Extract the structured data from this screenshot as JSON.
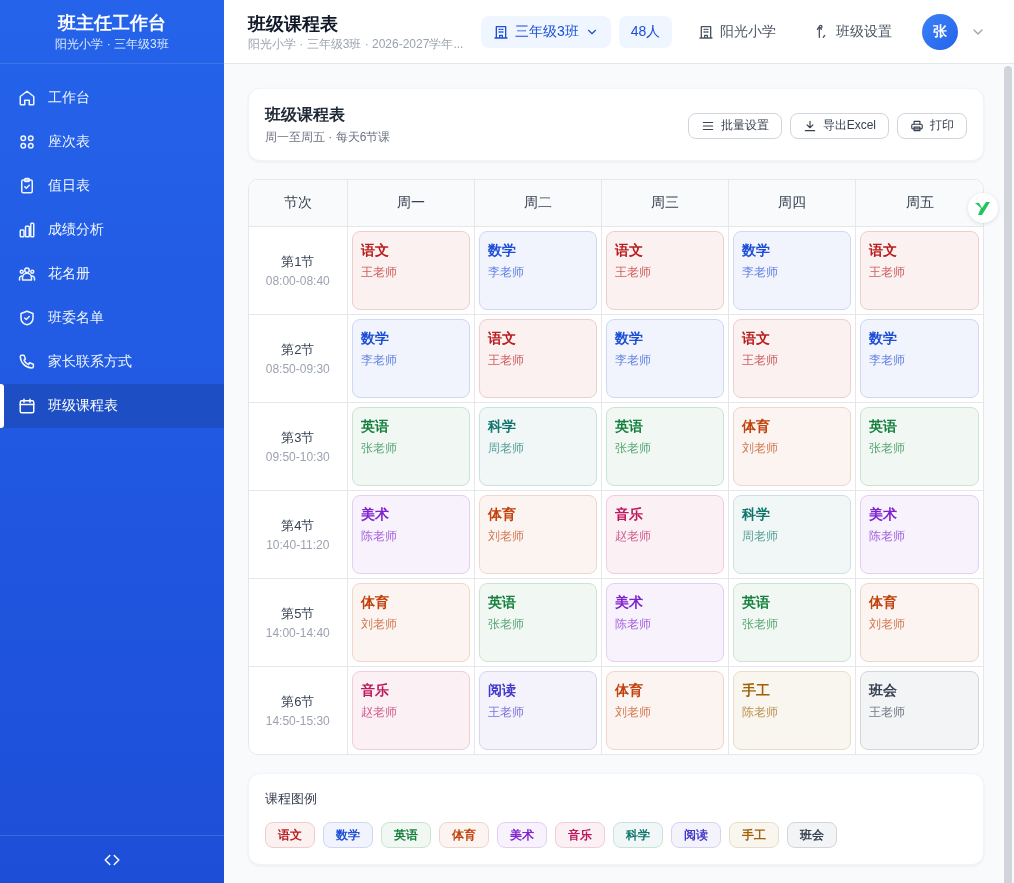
{
  "sidebar": {
    "title": "班主任工作台",
    "subtitle": "阳光小学 · 三年级3班",
    "items": [
      {
        "label": "工作台",
        "selected": false
      },
      {
        "label": "座次表",
        "selected": false
      },
      {
        "label": "值日表",
        "selected": false
      },
      {
        "label": "成绩分析",
        "selected": false
      },
      {
        "label": "花名册",
        "selected": false
      },
      {
        "label": "班委名单",
        "selected": false
      },
      {
        "label": "家长联系方式",
        "selected": false
      },
      {
        "label": "班级课程表",
        "selected": true
      }
    ]
  },
  "header": {
    "title": "班级课程表",
    "subtitle": "阳光小学 · 三年级3班 · 2026-2027学年...",
    "class_selector": "三年级3班",
    "student_count": "48人",
    "school": "阳光小学",
    "settings": "班级设置",
    "avatar": "张"
  },
  "schedule": {
    "title": "班级课程表",
    "subtitle": "周一至周五 · 每天6节课",
    "buttons": [
      "批量设置",
      "导出Excel",
      "打印"
    ],
    "period_header": "节次",
    "columns": [
      "周一",
      "周二",
      "周三",
      "周四",
      "周五"
    ],
    "rows": [
      {
        "period": "第1节",
        "time": "08:00-08:40",
        "cells": [
          {
            "subject": "语文",
            "teacher": "王老师",
            "color": "#b91c1c"
          },
          {
            "subject": "数学",
            "teacher": "李老师",
            "color": "#1d4ed8"
          },
          {
            "subject": "语文",
            "teacher": "王老师",
            "color": "#b91c1c"
          },
          {
            "subject": "数学",
            "teacher": "李老师",
            "color": "#1d4ed8"
          },
          {
            "subject": "语文",
            "teacher": "王老师",
            "color": "#b91c1c"
          }
        ]
      },
      {
        "period": "第2节",
        "time": "08:50-09:30",
        "cells": [
          {
            "subject": "数学",
            "teacher": "李老师",
            "color": "#1d4ed8"
          },
          {
            "subject": "语文",
            "teacher": "王老师",
            "color": "#b91c1c"
          },
          {
            "subject": "数学",
            "teacher": "李老师",
            "color": "#1d4ed8"
          },
          {
            "subject": "语文",
            "teacher": "王老师",
            "color": "#b91c1c"
          },
          {
            "subject": "数学",
            "teacher": "李老师",
            "color": "#1d4ed8"
          }
        ]
      },
      {
        "period": "第3节",
        "time": "09:50-10:30",
        "cells": [
          {
            "subject": "英语",
            "teacher": "张老师",
            "color": "#15803d"
          },
          {
            "subject": "科学",
            "teacher": "周老师",
            "color": "#0f766e"
          },
          {
            "subject": "英语",
            "teacher": "张老师",
            "color": "#15803d"
          },
          {
            "subject": "体育",
            "teacher": "刘老师",
            "color": "#c2410c"
          },
          {
            "subject": "英语",
            "teacher": "张老师",
            "color": "#15803d"
          }
        ]
      },
      {
        "period": "第4节",
        "time": "10:40-11:20",
        "cells": [
          {
            "subject": "美术",
            "teacher": "陈老师",
            "color": "#7e22ce"
          },
          {
            "subject": "体育",
            "teacher": "刘老师",
            "color": "#c2410c"
          },
          {
            "subject": "音乐",
            "teacher": "赵老师",
            "color": "#be185d"
          },
          {
            "subject": "科学",
            "teacher": "周老师",
            "color": "#0f766e"
          },
          {
            "subject": "美术",
            "teacher": "陈老师",
            "color": "#7e22ce"
          }
        ]
      },
      {
        "period": "第5节",
        "time": "14:00-14:40",
        "cells": [
          {
            "subject": "体育",
            "teacher": "刘老师",
            "color": "#c2410c"
          },
          {
            "subject": "英语",
            "teacher": "张老师",
            "color": "#15803d"
          },
          {
            "subject": "美术",
            "teacher": "陈老师",
            "color": "#7e22ce"
          },
          {
            "subject": "英语",
            "teacher": "张老师",
            "color": "#15803d"
          },
          {
            "subject": "体育",
            "teacher": "刘老师",
            "color": "#c2410c"
          }
        ]
      },
      {
        "period": "第6节",
        "time": "14:50-15:30",
        "cells": [
          {
            "subject": "音乐",
            "teacher": "赵老师",
            "color": "#be185d"
          },
          {
            "subject": "阅读",
            "teacher": "王老师",
            "color": "#4338ca"
          },
          {
            "subject": "体育",
            "teacher": "刘老师",
            "color": "#c2410c"
          },
          {
            "subject": "手工",
            "teacher": "陈老师",
            "color": "#a16207"
          },
          {
            "subject": "班会",
            "teacher": "王老师",
            "color": "#374151"
          }
        ]
      }
    ]
  },
  "legend": {
    "title": "课程图例",
    "items": [
      {
        "label": "语文",
        "color": "#b91c1c"
      },
      {
        "label": "数学",
        "color": "#1d4ed8"
      },
      {
        "label": "英语",
        "color": "#15803d"
      },
      {
        "label": "体育",
        "color": "#c2410c"
      },
      {
        "label": "美术",
        "color": "#7e22ce"
      },
      {
        "label": "音乐",
        "color": "#be185d"
      },
      {
        "label": "科学",
        "color": "#0f766e"
      },
      {
        "label": "阅读",
        "color": "#4338ca"
      },
      {
        "label": "手工",
        "color": "#a16207"
      },
      {
        "label": "班会",
        "color": "#374151"
      }
    ]
  }
}
